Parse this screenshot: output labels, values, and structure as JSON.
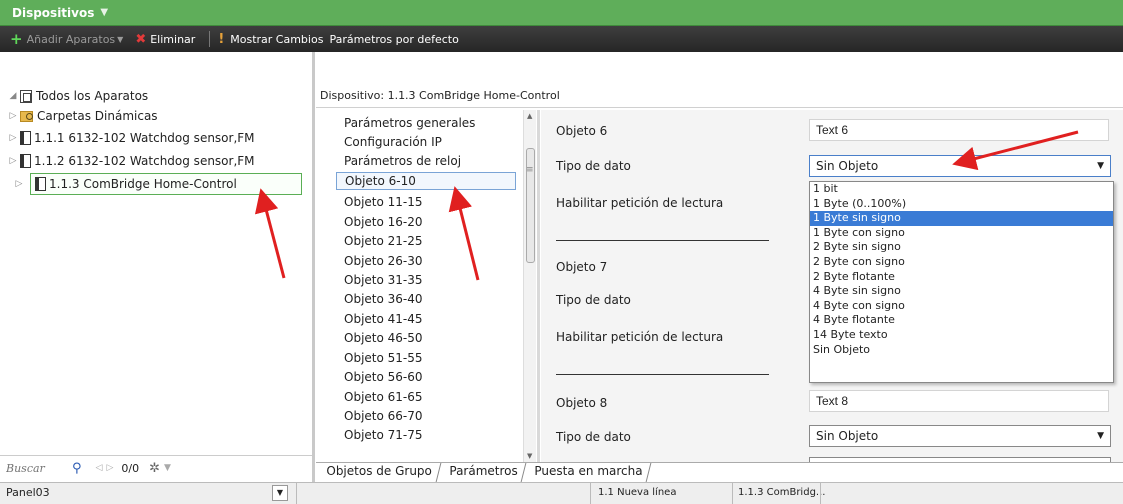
{
  "window": {
    "title": "Dispositivos"
  },
  "toolbar": {
    "add_label": "Añadir Aparatos",
    "delete_label": "Eliminar",
    "show_changes_label": "Mostrar Cambios",
    "defaults_label": "Parámetros por defecto"
  },
  "tree": {
    "root": "Todos los Aparatos",
    "items": [
      {
        "label": "Carpetas Dinámicas",
        "icon": "folder-icon"
      },
      {
        "label": "1.1.1  6132-102 Watchdog sensor,FM",
        "icon": "device-icon"
      },
      {
        "label": "1.1.2  6132-102 Watchdog sensor,FM",
        "icon": "device-icon"
      },
      {
        "label": "1.1.3  ComBridge Home-Control",
        "icon": "device-icon",
        "selected": true
      }
    ]
  },
  "left_footer": {
    "search_placeholder": "Buscar",
    "count": "0/0"
  },
  "device_header": "Dispositivo: 1.1.3  ComBridge Home-Control",
  "param_list": [
    "Parámetros generales",
    "Configuración IP",
    "Parámetros de reloj",
    "Objeto 6-10",
    "Objeto 11-15",
    "Objeto 16-20",
    "Objeto 21-25",
    "Objeto 26-30",
    "Objeto 31-35",
    "Objeto 36-40",
    "Objeto 41-45",
    "Objeto 46-50",
    "Objeto 51-55",
    "Objeto 56-60",
    "Objeto 61-65",
    "Objeto 66-70",
    "Objeto 71-75"
  ],
  "param_list_selected": "Objeto 6-10",
  "form": {
    "obj6_label": "Objeto 6",
    "obj6_value": "Text 6",
    "tipo_label": "Tipo de dato",
    "tipo_value": "Sin Objeto",
    "habilitar_label": "Habilitar petición de lectura",
    "obj7_label": "Objeto 7",
    "obj8_label": "Objeto 8",
    "obj8_value": "Text 8"
  },
  "dropdown_options": [
    "1 bit",
    "1 Byte (0..100%)",
    "1 Byte sin signo",
    "1 Byte con signo",
    "2 Byte sin signo",
    "2 Byte con signo",
    "2 Byte flotante",
    "4 Byte sin signo",
    "4 Byte con signo",
    "4 Byte flotante",
    "14 Byte texto",
    "Sin Objeto"
  ],
  "dropdown_highlighted": "1 Byte sin signo",
  "tabs": [
    "Objetos de Grupo",
    "Parámetros",
    "Puesta en marcha"
  ],
  "active_tab": "Parámetros",
  "statusbar": {
    "panel": "Panel03",
    "line": "1.1 Nueva línea",
    "device": "1.1.3  ComBridg..."
  },
  "colors": {
    "titlebar": "#5fae5a",
    "toolbar": "#2d2d2d",
    "highlight": "#3a7bd5",
    "annotation_arrow": "#e02020"
  }
}
